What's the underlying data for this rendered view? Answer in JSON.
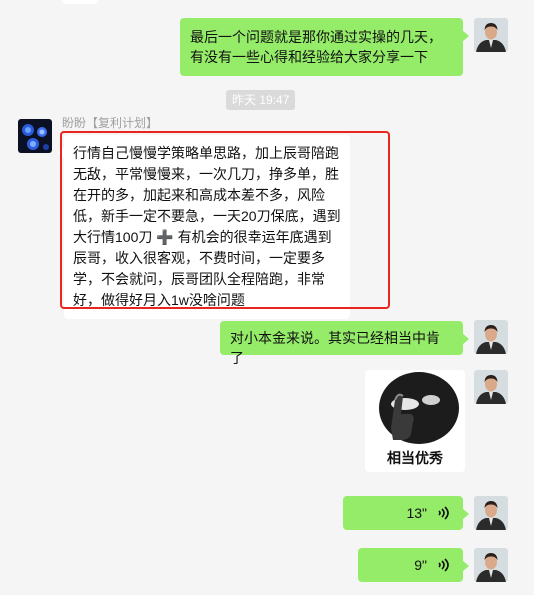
{
  "messages": {
    "m1": "最后一个问题就是那你通过实操的几天，有没有一些心得和经验给大家分享一下",
    "timestamp": "昨天 19:47",
    "sender_name": "盼盼【复利计划】",
    "m2": "行情自己慢慢学策略单思路，加上辰哥陪跑无敌，平常慢慢来，一次几刀，挣多单，胜在开的多，加起来和高成本差不多，风险低，新手一定不要急，一天20刀保底，遇到大行情100刀 ➕ 有机会的很幸运年底遇到辰哥，收入很客观，不费时间，一定要多学，不会就问，辰哥团队全程陪跑，非常好，做得好月入1w没啥问题",
    "m3": "对小本金来说。其实已经相当中肯了",
    "sticker_caption": "相当优秀",
    "voice1_duration": "13\"",
    "voice2_duration": "9\""
  },
  "colors": {
    "my_bubble": "#95ec69",
    "their_bubble": "#ffffff",
    "highlight_box": "#e8261f"
  },
  "icons": {
    "voice": "voice-wave-icon",
    "my_avatar": "man-in-suit-avatar",
    "their_avatar": "blue-roses-avatar"
  }
}
